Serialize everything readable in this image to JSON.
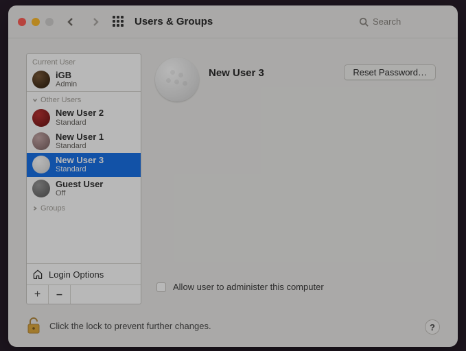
{
  "toolbar": {
    "title": "Users & Groups",
    "search_placeholder": "Search"
  },
  "sidebar": {
    "section_current": "Current User",
    "section_other": "Other Users",
    "section_groups": "Groups",
    "login_options": "Login Options",
    "current": {
      "name": "iGB",
      "role": "Admin",
      "avatar": "igb"
    },
    "others": [
      {
        "name": "New User 2",
        "role": "Standard",
        "avatar": "red",
        "selected": false
      },
      {
        "name": "New User 1",
        "role": "Standard",
        "avatar": "rose",
        "selected": false
      },
      {
        "name": "New User 3",
        "role": "Standard",
        "avatar": "golf",
        "selected": true
      },
      {
        "name": "Guest User",
        "role": "Off",
        "avatar": "grey",
        "selected": false
      }
    ],
    "add_label": "+",
    "remove_label": "–"
  },
  "main": {
    "user_name": "New User 3",
    "reset_password": "Reset Password…",
    "allow_admin": "Allow user to administer this computer",
    "allow_admin_checked": false
  },
  "footer": {
    "lock_text": "Click the lock to prevent further changes.",
    "help": "?"
  }
}
